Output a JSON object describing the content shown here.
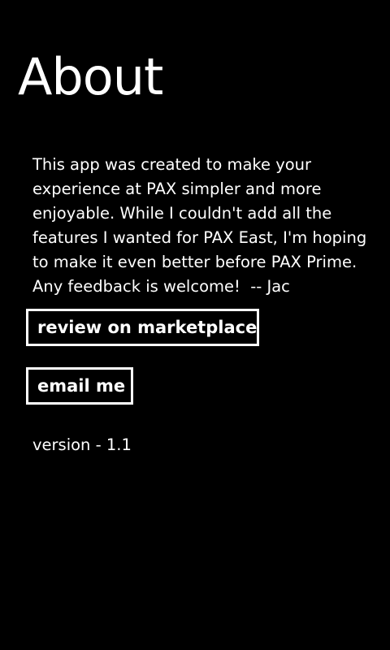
{
  "page": {
    "title": "About"
  },
  "about": {
    "lines": [
      "This app was created to make your",
      "experience at PAX simpler and more",
      "enjoyable. While I couldn't add all the",
      "features I wanted for PAX East, I'm hoping",
      "to make it even better before PAX Prime.",
      "Any feedback is welcome!  -- Jac"
    ]
  },
  "actions": {
    "review_label": "review on marketplace",
    "email_label": "email me"
  },
  "info": {
    "version": "version - 1.1"
  },
  "colors": {
    "background": "#000000",
    "foreground": "#ffffff"
  }
}
